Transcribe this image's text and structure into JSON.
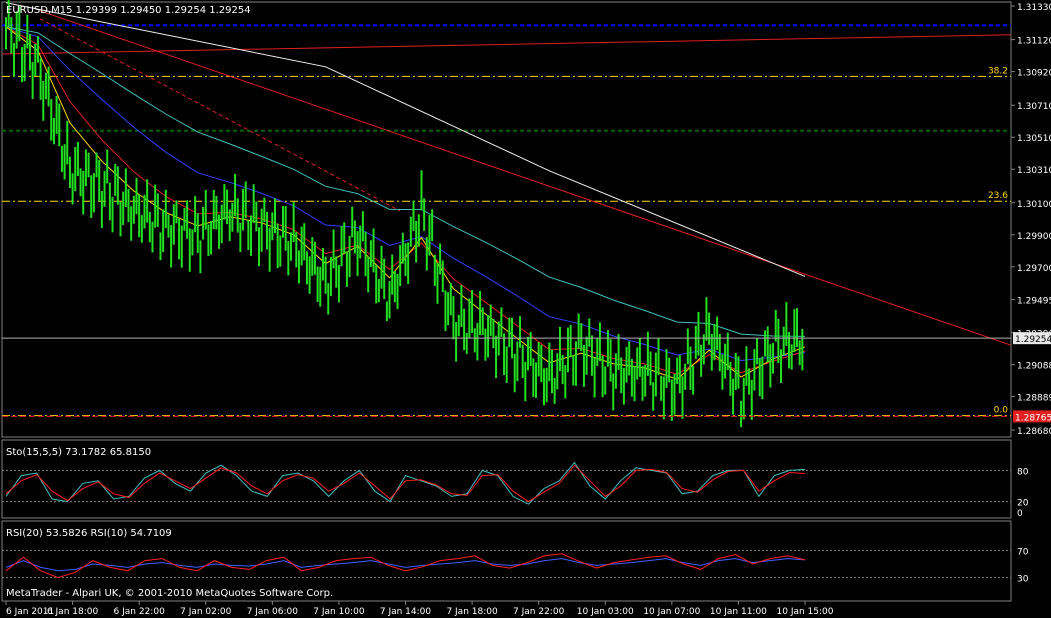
{
  "chart_data": [
    {
      "type": "candlestick",
      "title": "EURUSD,M15  1.29399 1.29450 1.29254 1.29254",
      "symbol": "EURUSD",
      "timeframe": "M15",
      "ohlc_header": [
        1.29399,
        1.2945,
        1.29254,
        1.29254
      ],
      "ylim": [
        1.2868,
        1.3133
      ],
      "y_ticks": [
        "1.31330",
        "1.31120",
        "1.30920",
        "1.30710",
        "1.30510",
        "1.30310",
        "1.30100",
        "1.29900",
        "1.29700",
        "1.29495",
        "1.29290",
        "1.29088",
        "1.28889",
        "1.28680"
      ],
      "current_price": "1.29254",
      "bid_line": "1.28765",
      "fib_levels": [
        {
          "label": "38.2",
          "value": 1.3089,
          "color": "#ffd800"
        },
        {
          "label": "23.6",
          "value": 1.3011,
          "color": "#ffd800"
        },
        {
          "label": "0.0",
          "value": 1.2877,
          "color": "#ffd800"
        }
      ],
      "horizontal_levels": [
        {
          "value": 1.3121,
          "color": "#0000ff"
        },
        {
          "value": 1.3055,
          "color": "#006400"
        }
      ],
      "close_path": [
        {
          "t": "6 Jan 2011",
          "close": 1.312
        },
        {
          "t": "6 Jan 14:00",
          "close": 1.3095
        },
        {
          "t": "6 Jan 16:00",
          "close": 1.303
        },
        {
          "t": "6 Jan 18:00",
          "close": 1.302
        },
        {
          "t": "6 Jan 20:00",
          "close": 1.3005
        },
        {
          "t": "6 Jan 22:00",
          "close": 1.2995
        },
        {
          "t": "7 Jan 00:00",
          "close": 1.299
        },
        {
          "t": "7 Jan 02:00",
          "close": 1.3005
        },
        {
          "t": "7 Jan 04:00",
          "close": 1.2995
        },
        {
          "t": "7 Jan 06:00",
          "close": 1.2985
        },
        {
          "t": "7 Jan 08:00",
          "close": 1.296
        },
        {
          "t": "7 Jan 10:00",
          "close": 1.299
        },
        {
          "t": "7 Jan 12:00",
          "close": 1.295
        },
        {
          "t": "7 Jan 14:00",
          "close": 1.3005
        },
        {
          "t": "7 Jan 16:00",
          "close": 1.2935
        },
        {
          "t": "7 Jan 18:00",
          "close": 1.293
        },
        {
          "t": "7 Jan 20:00",
          "close": 1.2915
        },
        {
          "t": "7 Jan 22:00",
          "close": 1.29
        },
        {
          "t": "10 Jan 01:00",
          "close": 1.292
        },
        {
          "t": "10 Jan 03:00",
          "close": 1.2905
        },
        {
          "t": "10 Jan 05:00",
          "close": 1.2905
        },
        {
          "t": "10 Jan 07:00",
          "close": 1.2895
        },
        {
          "t": "10 Jan 09:00",
          "close": 1.293
        },
        {
          "t": "10 Jan 11:00",
          "close": 1.289
        },
        {
          "t": "10 Jan 13:00",
          "close": 1.292
        },
        {
          "t": "10 Jan 15:00",
          "close": 1.2925
        }
      ],
      "x_ticks": [
        "6 Jan 2011",
        "6 Jan 18:00",
        "6 Jan 22:00",
        "7 Jan 02:00",
        "7 Jan 06:00",
        "7 Jan 10:00",
        "7 Jan 14:00",
        "7 Jan 18:00",
        "7 Jan 22:00",
        "10 Jan 03:00",
        "10 Jan 07:00",
        "10 Jan 11:00",
        "10 Jan 15:00"
      ],
      "footer": "MetaTrader - Alpari UK, © 2001-2010 MetaQuotes Software Corp."
    },
    {
      "type": "line",
      "title": "Sto(15,5,5) 73.1782 65.8150",
      "ylim": [
        0,
        100
      ],
      "y_ticks": [
        "80",
        "20",
        "0"
      ],
      "series": [
        {
          "color": "#3fc0c0",
          "values": [
            30,
            70,
            75,
            25,
            20,
            55,
            60,
            25,
            30,
            65,
            80,
            55,
            40,
            75,
            90,
            70,
            40,
            30,
            70,
            75,
            60,
            30,
            60,
            80,
            40,
            20,
            70,
            60,
            50,
            30,
            35,
            80,
            70,
            30,
            15,
            45,
            60,
            95,
            50,
            25,
            60,
            85,
            80,
            75,
            35,
            40,
            70,
            80,
            80,
            30,
            70,
            80,
            82
          ]
        },
        {
          "color": "#ff2020",
          "values": [
            35,
            60,
            72,
            40,
            22,
            45,
            58,
            35,
            28,
            55,
            75,
            60,
            45,
            65,
            85,
            75,
            50,
            35,
            60,
            72,
            65,
            40,
            55,
            75,
            50,
            25,
            60,
            62,
            52,
            35,
            32,
            70,
            72,
            40,
            20,
            38,
            55,
            90,
            60,
            30,
            50,
            80,
            82,
            76,
            45,
            38,
            62,
            78,
            80,
            40,
            60,
            76,
            74
          ]
        }
      ]
    },
    {
      "type": "line",
      "title": "RSI(20) 53.5826 RSI(10) 54.7109",
      "ylim": [
        0,
        100
      ],
      "y_ticks": [
        "70",
        "30"
      ],
      "series": [
        {
          "color": "#4060ff",
          "values": [
            45,
            55,
            45,
            40,
            42,
            50,
            48,
            45,
            50,
            52,
            48,
            45,
            50,
            48,
            47,
            50,
            55,
            45,
            48,
            50,
            52,
            55,
            50,
            45,
            48,
            50,
            52,
            55,
            50,
            48,
            50,
            55,
            58,
            52,
            48,
            50,
            52,
            55,
            58,
            52,
            48,
            55,
            58,
            52,
            55,
            58,
            56
          ]
        },
        {
          "color": "#ff2020",
          "values": [
            40,
            60,
            40,
            30,
            38,
            55,
            45,
            40,
            55,
            58,
            45,
            40,
            55,
            45,
            42,
            55,
            60,
            40,
            45,
            55,
            58,
            60,
            48,
            40,
            46,
            55,
            58,
            62,
            48,
            44,
            52,
            62,
            65,
            54,
            44,
            52,
            56,
            60,
            62,
            50,
            42,
            58,
            64,
            50,
            58,
            62,
            56
          ]
        }
      ]
    }
  ]
}
